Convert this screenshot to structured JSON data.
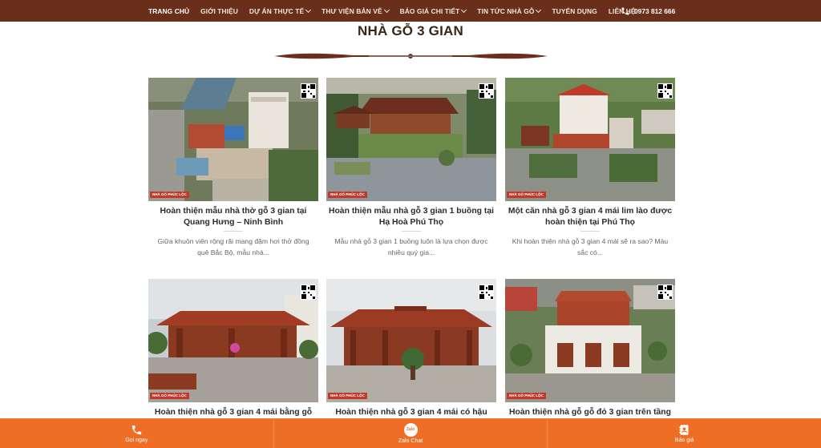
{
  "nav": {
    "items": [
      {
        "label": "TRANG CHỦ",
        "active": true,
        "dropdown": false
      },
      {
        "label": "GIỚI THIỆU",
        "active": false,
        "dropdown": false
      },
      {
        "label": "DỰ ÁN THỰC TẾ",
        "active": false,
        "dropdown": true
      },
      {
        "label": "THƯ VIỆN BẢN VẼ",
        "active": false,
        "dropdown": true
      },
      {
        "label": "BÁO GIÁ CHI TIẾT",
        "active": false,
        "dropdown": true
      },
      {
        "label": "TIN TỨC NHÀ GỖ",
        "active": false,
        "dropdown": true
      },
      {
        "label": "TUYỂN DỤNG",
        "active": false,
        "dropdown": false
      },
      {
        "label": "LIÊN HỆ",
        "active": false,
        "dropdown": false
      }
    ],
    "phone": "0973 812 666"
  },
  "section": {
    "title": "NHÀ GỖ 3 GIAN"
  },
  "watermark": "NHÀ GỖ PHÚC LỘC",
  "cards": [
    {
      "title": "Hoàn thiện mẫu nhà thờ gỗ 3 gian tại Quang Hưng – Ninh Bình",
      "desc": "Giữa khuôn viên rộng rãi mang đậm hơi thở đồng quê Bắc Bộ, mẫu nhà..."
    },
    {
      "title": "Hoàn thiện mẫu nhà gỗ 3 gian 1 buồng tại Hạ Hoà Phú Thọ",
      "desc": "Mẫu nhà gỗ 3 gian 1 buồng luôn là lựa chọn được nhiều quý gia..."
    },
    {
      "title": "Một căn nhà gỗ 3 gian 4 mái lim lào được hoàn thiện tại Phú Thọ",
      "desc": "Khi hoàn thiện nhà gỗ 3 gian 4 mái sẽ ra sao? Màu sắc có..."
    },
    {
      "title": "Hoàn thiện nhà gỗ 3 gian 4 mái bằng gỗ",
      "desc": ""
    },
    {
      "title": "Hoàn thiện nhà gỗ 3 gian 4 mái có hậu",
      "desc": ""
    },
    {
      "title": "Hoàn thiện nhà gỗ gỗ đỏ 3 gian trên tầng",
      "desc": ""
    }
  ],
  "bottombar": {
    "call_label": "Gọi ngay",
    "zalo_label": "Zalo Chat",
    "zalo_icon_text": "Zalo",
    "quote_label": "Báo giá"
  },
  "colors": {
    "nav_bg": "#6a2f1a",
    "bottom_bar": "#ef6e25",
    "title": "#3a2518"
  }
}
